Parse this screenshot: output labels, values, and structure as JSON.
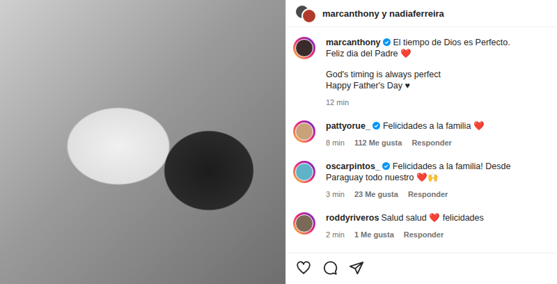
{
  "post": {
    "accounts": "marcanthony y nadiaferreira"
  },
  "caption": {
    "user": "marcanthony",
    "verified": true,
    "paragraphs": [
      [
        "El tiempo de Dios es Perfecto.",
        "Feliz dia del Padre ❤️"
      ],
      [
        "God's timing is always perfect",
        "Happy Father's Day ♥"
      ]
    ],
    "time": "12 min"
  },
  "comments": [
    {
      "user": "pattyorue_",
      "verified": true,
      "text": "Felicidades a la familia ❤️",
      "time": "8 min",
      "likes": "112 Me gusta",
      "reply": "Responder",
      "color": "#c9a27a"
    },
    {
      "user": "oscarpintos_",
      "verified": true,
      "text": "Felicidades a la familia! Desde Paraguay todo nuestro ❤️🙌",
      "time": "3 min",
      "likes": "23 Me gusta",
      "reply": "Responder",
      "color": "#5fb3c9"
    },
    {
      "user": "roddyriveros",
      "verified": false,
      "text": "Salud salud ❤️ felicidades",
      "time": "2 min",
      "likes": "1 Me gusta",
      "reply": "Responder",
      "color": "#7a6a55"
    }
  ]
}
